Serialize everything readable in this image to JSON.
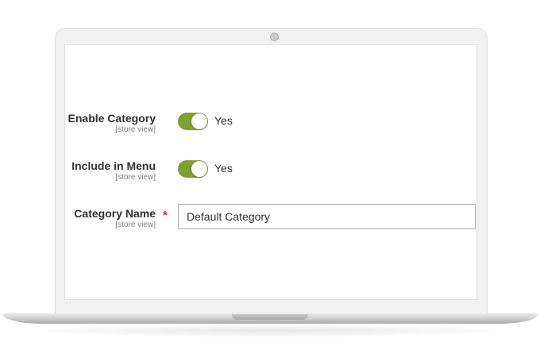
{
  "form": {
    "enable_category": {
      "label": "Enable Category",
      "scope": "[store view]",
      "toggle_on": true,
      "toggle_text": "Yes"
    },
    "include_in_menu": {
      "label": "Include in Menu",
      "scope": "[store view]",
      "toggle_on": true,
      "toggle_text": "Yes"
    },
    "category_name": {
      "label": "Category Name",
      "scope": "[store view]",
      "required_mark": "*",
      "value": "Default Category"
    }
  },
  "colors": {
    "toggle_on": "#79a22e",
    "required": "#e22626",
    "label_text": "#303030",
    "scope_text": "#808080"
  },
  "icons": {
    "camera": "webcam-dot"
  }
}
